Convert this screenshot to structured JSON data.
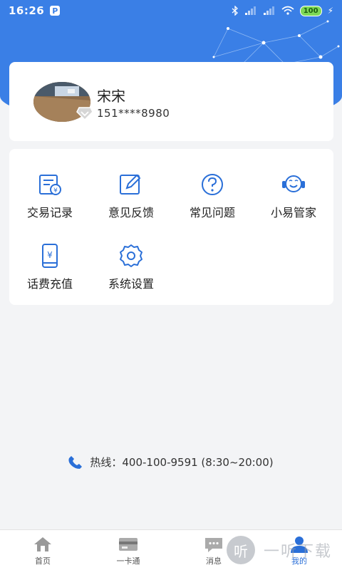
{
  "status_bar": {
    "time": "16:26",
    "p_badge": "P",
    "battery": "100",
    "bolt": "⚡"
  },
  "profile": {
    "name": "宋宋",
    "phone": "151****8980"
  },
  "menu": [
    {
      "label": "交易记录",
      "icon": "transaction-record-icon"
    },
    {
      "label": "意见反馈",
      "icon": "feedback-edit-icon"
    },
    {
      "label": "常见问题",
      "icon": "faq-question-icon"
    },
    {
      "label": "小易管家",
      "icon": "customer-service-icon"
    },
    {
      "label": "话费充值",
      "icon": "phone-recharge-icon"
    },
    {
      "label": "系统设置",
      "icon": "settings-gear-icon"
    }
  ],
  "hotline": {
    "text": "热线：400-100-9591 (8:30~20:00)"
  },
  "tabbar": [
    {
      "label": "首页",
      "icon": "home-icon",
      "active": false
    },
    {
      "label": "一卡通",
      "icon": "card-icon",
      "active": false
    },
    {
      "label": "消息",
      "icon": "message-icon",
      "active": false
    },
    {
      "label": "我的",
      "icon": "user-icon",
      "active": true
    }
  ],
  "watermark": {
    "circle": "听",
    "text": "一听下载"
  },
  "colors": {
    "brand": "#3a7fe6",
    "icon_blue": "#2a6fd8",
    "background": "#f3f4f6"
  }
}
